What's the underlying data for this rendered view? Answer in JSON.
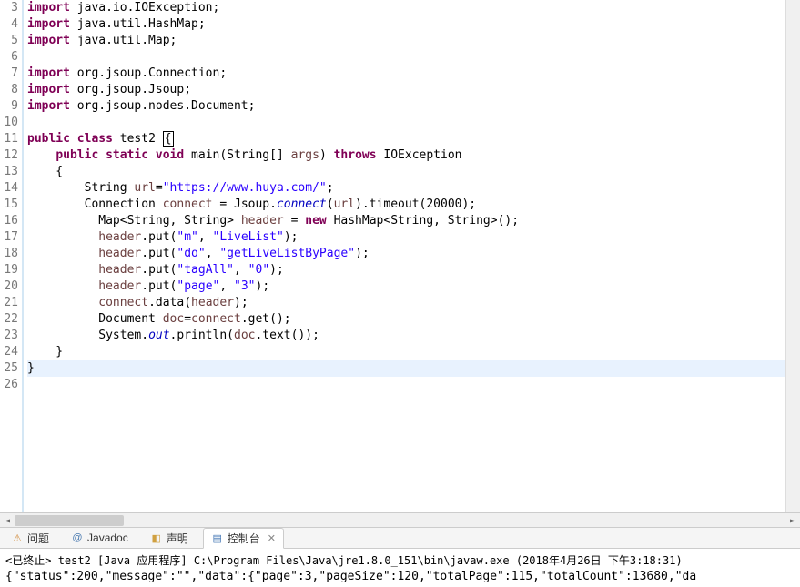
{
  "code": {
    "lines": [
      {
        "n": 3,
        "tokens": [
          [
            "kw",
            "import"
          ],
          [
            "",
            " java.io.IOException;"
          ]
        ]
      },
      {
        "n": 4,
        "tokens": [
          [
            "kw",
            "import"
          ],
          [
            "",
            " java.util.HashMap;"
          ]
        ]
      },
      {
        "n": 5,
        "tokens": [
          [
            "kw",
            "import"
          ],
          [
            "",
            " java.util.Map;"
          ]
        ]
      },
      {
        "n": 6,
        "tokens": [
          [
            "",
            ""
          ]
        ]
      },
      {
        "n": 7,
        "tokens": [
          [
            "kw",
            "import"
          ],
          [
            "",
            " org.jsoup.Connection;"
          ]
        ]
      },
      {
        "n": 8,
        "tokens": [
          [
            "kw",
            "import"
          ],
          [
            "",
            " org.jsoup.Jsoup;"
          ]
        ]
      },
      {
        "n": 9,
        "tokens": [
          [
            "kw",
            "import"
          ],
          [
            "",
            " org.jsoup.nodes.Document;"
          ]
        ]
      },
      {
        "n": 10,
        "tokens": [
          [
            "",
            ""
          ]
        ]
      },
      {
        "n": 11,
        "tokens": [
          [
            "kw",
            "public"
          ],
          [
            "",
            " "
          ],
          [
            "kw",
            "class"
          ],
          [
            "",
            " test2 "
          ],
          [
            "cursor",
            "{"
          ]
        ]
      },
      {
        "n": 12,
        "tokens": [
          [
            "",
            "    "
          ],
          [
            "kw",
            "public"
          ],
          [
            "",
            " "
          ],
          [
            "kw",
            "static"
          ],
          [
            "",
            " "
          ],
          [
            "kw",
            "void"
          ],
          [
            "",
            " main(String[] "
          ],
          [
            "param",
            "args"
          ],
          [
            "",
            ") "
          ],
          [
            "kw",
            "throws"
          ],
          [
            "",
            " IOException"
          ]
        ]
      },
      {
        "n": 13,
        "tokens": [
          [
            "",
            "    {"
          ]
        ]
      },
      {
        "n": 14,
        "tokens": [
          [
            "",
            "        String "
          ],
          [
            "var",
            "url"
          ],
          [
            "",
            "="
          ],
          [
            "str",
            "\"https://www.huya.com/\""
          ],
          [
            "",
            ";"
          ]
        ]
      },
      {
        "n": 15,
        "tokens": [
          [
            "",
            "        Connection "
          ],
          [
            "var",
            "connect"
          ],
          [
            "",
            " = Jsoup."
          ],
          [
            "field-italic",
            "connect"
          ],
          [
            "",
            "("
          ],
          [
            "var",
            "url"
          ],
          [
            "",
            ").timeout(20000);"
          ]
        ]
      },
      {
        "n": 16,
        "tokens": [
          [
            "",
            "          Map<String, String> "
          ],
          [
            "var",
            "header"
          ],
          [
            "",
            " = "
          ],
          [
            "kw",
            "new"
          ],
          [
            "",
            " HashMap<String, String>();"
          ]
        ]
      },
      {
        "n": 17,
        "tokens": [
          [
            "",
            "          "
          ],
          [
            "var",
            "header"
          ],
          [
            "",
            ".put("
          ],
          [
            "str",
            "\"m\""
          ],
          [
            "",
            ", "
          ],
          [
            "str",
            "\"LiveList\""
          ],
          [
            "",
            ");"
          ]
        ]
      },
      {
        "n": 18,
        "tokens": [
          [
            "",
            "          "
          ],
          [
            "var",
            "header"
          ],
          [
            "",
            ".put("
          ],
          [
            "str",
            "\"do\""
          ],
          [
            "",
            ", "
          ],
          [
            "str",
            "\"getLiveListByPage\""
          ],
          [
            "",
            ");"
          ]
        ]
      },
      {
        "n": 19,
        "tokens": [
          [
            "",
            "          "
          ],
          [
            "var",
            "header"
          ],
          [
            "",
            ".put("
          ],
          [
            "str",
            "\"tagAll\""
          ],
          [
            "",
            ", "
          ],
          [
            "str",
            "\"0\""
          ],
          [
            "",
            ");"
          ]
        ]
      },
      {
        "n": 20,
        "tokens": [
          [
            "",
            "          "
          ],
          [
            "var",
            "header"
          ],
          [
            "",
            ".put("
          ],
          [
            "str",
            "\"page\""
          ],
          [
            "",
            ", "
          ],
          [
            "str",
            "\"3\""
          ],
          [
            "",
            ");"
          ]
        ]
      },
      {
        "n": 21,
        "tokens": [
          [
            "",
            "          "
          ],
          [
            "var",
            "connect"
          ],
          [
            "",
            ".data("
          ],
          [
            "var",
            "header"
          ],
          [
            "",
            ");"
          ]
        ]
      },
      {
        "n": 22,
        "tokens": [
          [
            "",
            "          Document "
          ],
          [
            "var",
            "doc"
          ],
          [
            "",
            "="
          ],
          [
            "var",
            "connect"
          ],
          [
            "",
            ".get();"
          ]
        ]
      },
      {
        "n": 23,
        "tokens": [
          [
            "",
            "          System."
          ],
          [
            "field-italic",
            "out"
          ],
          [
            "",
            ".println("
          ],
          [
            "var",
            "doc"
          ],
          [
            "",
            ".text());"
          ]
        ]
      },
      {
        "n": 24,
        "tokens": [
          [
            "",
            "    }"
          ]
        ]
      },
      {
        "n": 25,
        "tokens": [
          [
            "",
            "}"
          ]
        ],
        "hl": true
      },
      {
        "n": 26,
        "tokens": [
          [
            "",
            ""
          ]
        ]
      }
    ]
  },
  "tabs": {
    "items": [
      {
        "label": "问题",
        "iconColor": "#d08a3a",
        "iconChar": "⚠"
      },
      {
        "label": "Javadoc",
        "iconColor": "#4a7ab0",
        "iconChar": "@"
      },
      {
        "label": "声明",
        "iconColor": "#d0a040",
        "iconChar": "◧"
      },
      {
        "label": "控制台",
        "iconColor": "#3a6fb0",
        "iconChar": "▤",
        "active": true,
        "close": "✕"
      }
    ]
  },
  "console": {
    "status_prefix": "<已终止> ",
    "process": "test2 [Java 应用程序] C:\\Program Files\\Java\\jre1.8.0_151\\bin\\javaw.exe",
    "timestamp": "  (2018年4月26日 下午3:18:31)",
    "output": "{\"status\":200,\"message\":\"\",\"data\":{\"page\":3,\"pageSize\":120,\"totalPage\":115,\"totalCount\":13680,\"da"
  }
}
